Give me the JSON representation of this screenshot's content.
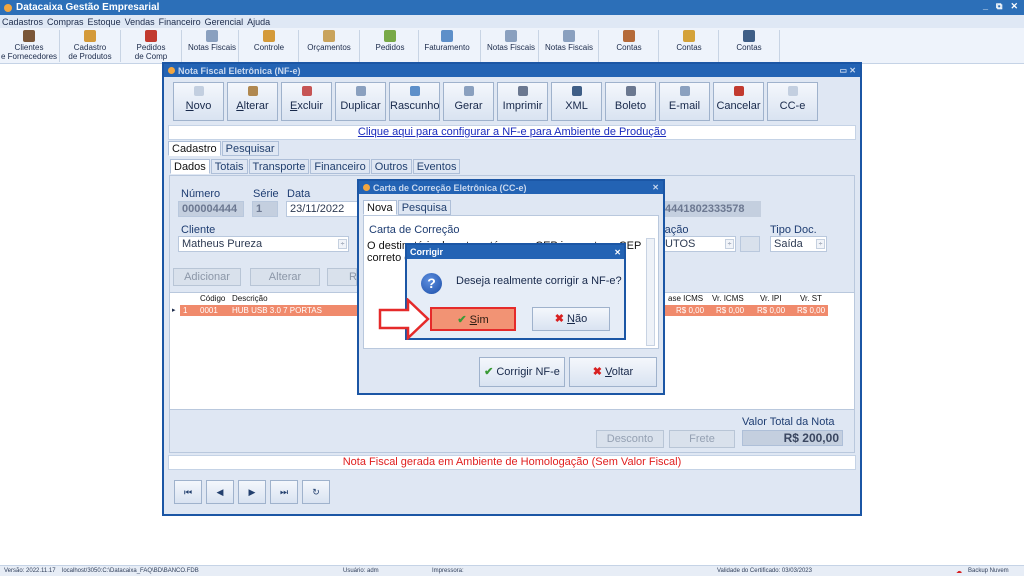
{
  "app": {
    "title": "Datacaixa Gestão Empresarial",
    "window_controls": [
      "_",
      "⧉",
      "✕"
    ],
    "menu": [
      "Cadastros",
      "Compras",
      "Estoque",
      "Vendas",
      "Financeiro",
      "Gerencial",
      "Ajuda"
    ],
    "toolbar": [
      {
        "l1": "Clientes",
        "l2": "e Fornecedores",
        "icon": "users-icon"
      },
      {
        "l1": "Cadastro",
        "l2": "de Produtos",
        "icon": "boxes-icon"
      },
      {
        "l1": "Pedidos",
        "l2": "de Comp",
        "icon": "order-book-icon"
      },
      {
        "l1": "Notas Fiscais",
        "l2": "",
        "icon": "invoice-icon"
      },
      {
        "l1": "Controle",
        "l2": "",
        "icon": "stock-icon"
      },
      {
        "l1": "Orçamentos",
        "l2": "",
        "icon": "quote-icon"
      },
      {
        "l1": "Pedidos",
        "l2": "",
        "icon": "sales-order-icon"
      },
      {
        "l1": "Faturamento",
        "l2": "",
        "icon": "billing-icon"
      },
      {
        "l1": "Notas Fiscais",
        "l2": "",
        "icon": "invoice-icon"
      },
      {
        "l1": "Notas Fiscais",
        "l2": "",
        "icon": "invoice-icon"
      },
      {
        "l1": "Contas",
        "l2": "",
        "icon": "payables-icon"
      },
      {
        "l1": "Contas",
        "l2": "",
        "icon": "receivables-icon"
      },
      {
        "l1": "Contas",
        "l2": "",
        "icon": "accounts-icon"
      }
    ]
  },
  "nfe": {
    "title": "Nota Fiscal Eletrônica (NF-e)",
    "buttons": [
      {
        "label": "Novo",
        "u": "N",
        "rest": "ovo"
      },
      {
        "label": "Alterar",
        "u": "A",
        "rest": "lterar"
      },
      {
        "label": "Excluir",
        "u": "E",
        "rest": "xcluir"
      },
      {
        "label": "Duplicar",
        "u": "",
        "rest": "Duplicar"
      },
      {
        "label": "Rascunho",
        "u": "",
        "rest": "Rascunho"
      },
      {
        "label": "Gerar",
        "u": "",
        "rest": "Gerar"
      },
      {
        "label": "Imprimir",
        "u": "",
        "rest": "Imprimir"
      },
      {
        "label": "XML",
        "u": "",
        "rest": "XML"
      },
      {
        "label": "Boleto",
        "u": "",
        "rest": "Boleto"
      },
      {
        "label": "E-mail",
        "u": "",
        "rest": "E-mail"
      },
      {
        "label": "Cancelar",
        "u": "",
        "rest": "Cancelar"
      },
      {
        "label": "CC-e",
        "u": "",
        "rest": "CC-e"
      }
    ],
    "config_link": "Clique aqui para configurar a NF-e para Ambiente de Produção",
    "main_tabs": [
      "Cadastro",
      "Pesquisar"
    ],
    "sub_tabs": [
      "Dados",
      "Totais",
      "Transporte",
      "Financeiro",
      "Outros",
      "Eventos"
    ],
    "numero_label": "Número",
    "numero": "000004444",
    "serie_label": "Série",
    "serie": "1",
    "data_label": "Data",
    "data": "23/11/2022",
    "chave_partial": "4441802333578",
    "cliente_label": "Cliente",
    "cliente": "Matheus Pureza",
    "operacao_label_partial": "ração",
    "operacao_partial": "UTOS",
    "tipo_doc_label": "Tipo Doc.",
    "tipo_doc": "Saída",
    "btn_adicionar": "Adicionar",
    "btn_alterar": "Alterar",
    "btn_r_partial": "R",
    "grid_headers": {
      "codigo": "Código",
      "descricao": "Descrição",
      "base_icms": "ase ICMS",
      "vr_icms": "Vr. ICMS",
      "vr_ipi": "Vr. IPI",
      "vr_st": "Vr. ST"
    },
    "row": {
      "n": "1",
      "codigo": "0001",
      "descricao": "HUB USB 3.0 7 PORTAS",
      "base_icms": "R$ 0,00",
      "vr_icms": "R$ 0,00",
      "vr_ipi": "R$ 0,00",
      "vr_st": "R$ 0,00"
    },
    "btn_desconto": "Desconto",
    "btn_frete": "Frete",
    "total_label": "Valor Total da Nota",
    "total_value": "R$ 200,00",
    "homolog_msg": "Nota Fiscal gerada em Ambiente de Homologação (Sem Valor Fiscal)",
    "nav": [
      "⏮",
      "◀",
      "▶",
      "⏭",
      "↻"
    ]
  },
  "cce": {
    "title": "Carta de Correção Eletrônica (CC-e)",
    "tabs": [
      "Nova",
      "Pesquisa"
    ],
    "label": "Carta de Correção",
    "text": "O destinatário da nota está com o CEP incorreto, o CEP correto é",
    "btn_corrigir": "Corrigir NF-e",
    "btn_voltar_u": "V",
    "btn_voltar_rest": "oltar"
  },
  "confirm": {
    "title": "Corrigir",
    "question": "Deseja realmente corrigir a NF-e?",
    "yes_u": "S",
    "yes_rest": "im",
    "no_u": "N",
    "no_rest": "ão",
    "highlight_color": "#e52a2a"
  },
  "status": {
    "versao": "Versão: 2022.11.17",
    "db": "localhost/3050:C:\\Datacaixa_FAQ\\BD\\BANCO.FDB",
    "usuario": "Usuário: adm",
    "impressora": "Impressora:",
    "validade": "Validade do Certificado: 03/03/2023",
    "backup": "Backup Nuvem"
  }
}
